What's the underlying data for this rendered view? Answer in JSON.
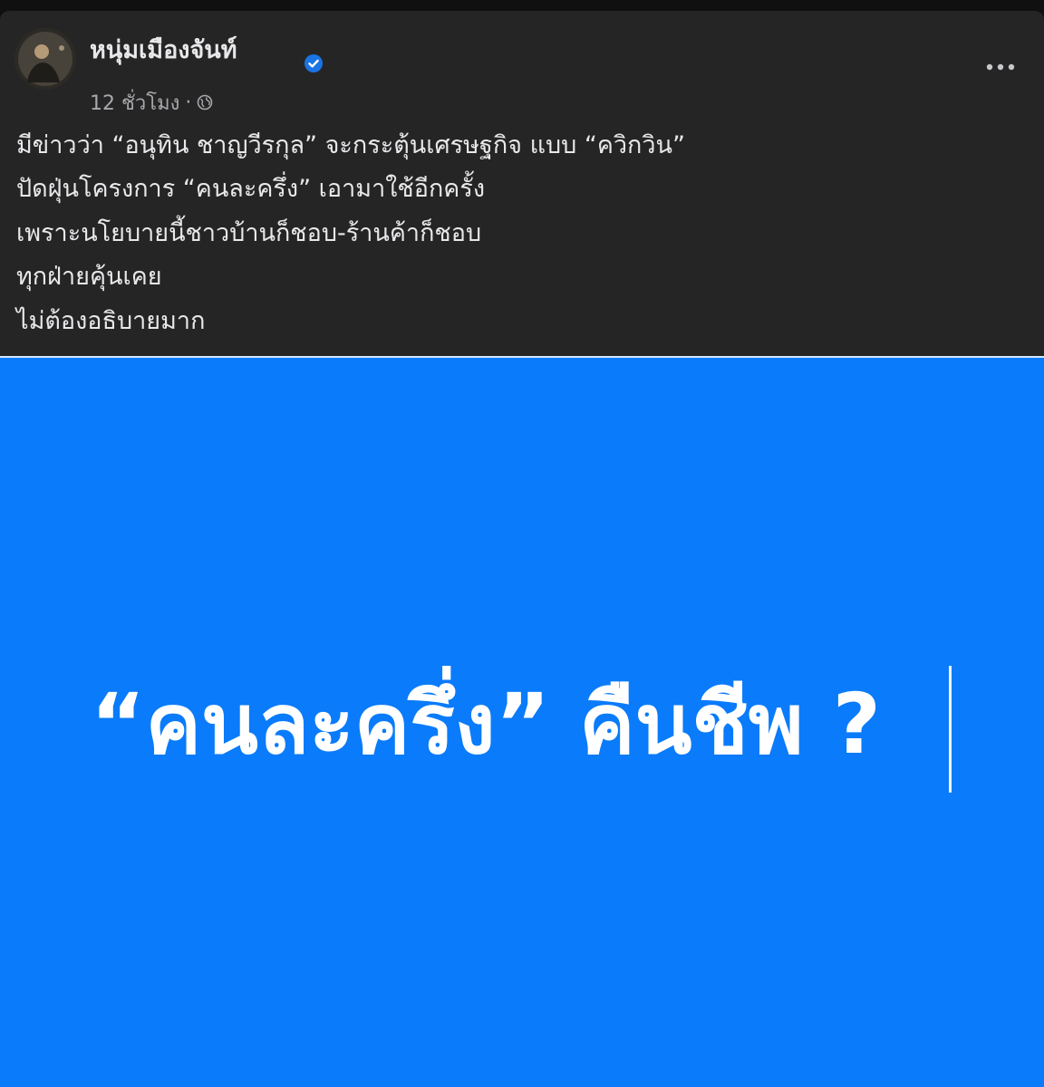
{
  "post": {
    "author": {
      "name": "หนุ่มเมืองจันท์",
      "verified": true,
      "avatar_icon": "profile-photo"
    },
    "meta": {
      "time": "12 ชั่วโมง",
      "separator": "·",
      "audience_icon": "globe-icon"
    },
    "more_icon": "more-horizontal-icon",
    "text_lines": [
      "มีข่าวว่า “อนุทิน ชาญวีรกุล” จะกระตุ้นเศรษฐกิจ แบบ “ควิกวิน”",
      "ปัดฝุ่นโครงการ “คนละครึ่ง” เอามาใช้อีกครั้ง",
      "เพราะนโยบายนี้ชาวบ้านก็ชอบ-ร้านค้าก็ชอบ",
      "ทุกฝ่ายคุ้นเคย",
      "ไม่ต้องอธิบายมาก"
    ],
    "image": {
      "headline": "“คนละครึ่ง” คืนชีพ ?",
      "background_color": "#0a7bfa",
      "text_color": "#ffffff"
    }
  },
  "colors": {
    "card_background": "#252526",
    "page_background": "#0f0f10",
    "primary_text": "#e8e8ea",
    "secondary_text": "#a7a8ab",
    "verified_badge": "#1b74e4"
  }
}
